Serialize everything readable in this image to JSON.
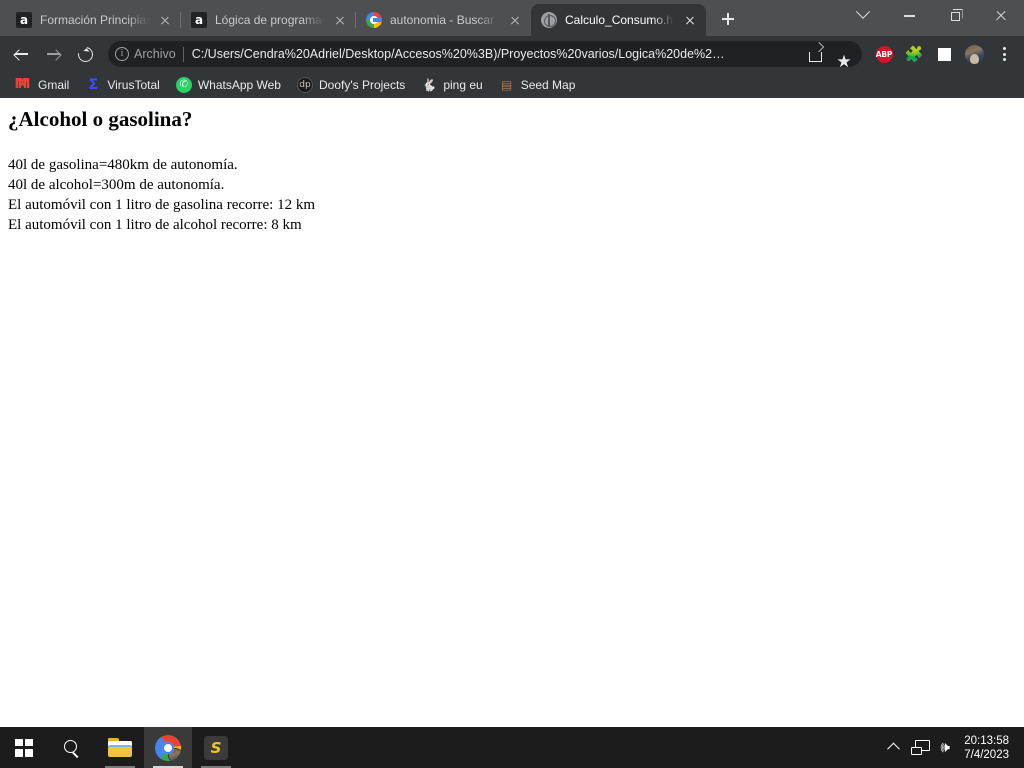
{
  "browser": {
    "tabs": [
      {
        "title": "Formación Principiante",
        "favicon": "alura-a-icon",
        "active": false
      },
      {
        "title": "Lógica de programación",
        "favicon": "alura-a-icon",
        "active": false
      },
      {
        "title": "autonomia - Buscar con",
        "favicon": "google-icon",
        "active": false
      },
      {
        "title": "Calculo_Consumo.htm",
        "favicon": "globe-icon",
        "active": true
      }
    ],
    "new_tab_label": "+",
    "window_controls": {
      "tab_search": "tab-search",
      "minimize": "minimize",
      "maximize": "maximize",
      "close": "close"
    },
    "toolbar": {
      "back": "back",
      "forward": "forward",
      "reload": "reload",
      "scheme_label": "Archivo",
      "url": "C:/Users/Cendra%20Adriel/Desktop/Accesos%20%3B)/Proyectos%20varios/Logica%20de%2…",
      "share": "share",
      "bookmark_star": "★",
      "abp_label": "ABP",
      "extensions": "🧩",
      "reading_list": "reading-list",
      "profile": "profile",
      "menu": "menu"
    },
    "bookmarks": [
      {
        "label": "Gmail",
        "icon": "M",
        "icon_class": "ic-gmail"
      },
      {
        "label": "VirusTotal",
        "icon": "Σ",
        "icon_class": "ic-vt"
      },
      {
        "label": "WhatsApp Web",
        "icon": "✆",
        "icon_class": "ic-wa"
      },
      {
        "label": "Doofy's Projects",
        "icon": "dp",
        "icon_class": "ic-doofy"
      },
      {
        "label": "ping eu",
        "icon": "🐇",
        "icon_class": "ic-ping"
      },
      {
        "label": "Seed Map",
        "icon": "▤",
        "icon_class": "ic-seed"
      }
    ]
  },
  "page": {
    "heading": "¿Alcohol o gasolina?",
    "lines": [
      "40l de gasolina=480km de autonomía.",
      "40l de alcohol=300m de autonomía.",
      "El automóvil con 1 litro de gasolina recorre: 12 km",
      "El automóvil con 1 litro de alcohol recorre: 8 km"
    ]
  },
  "taskbar": {
    "start": "windows-start",
    "search": "search",
    "file_explorer": "file-explorer",
    "chrome": "google-chrome",
    "sublime": "sublime-text",
    "sublime_glyph": "S",
    "tray": {
      "show_hidden": "show-hidden-icons",
      "network": "network",
      "volume": "volume",
      "volume_glyph": "🕪",
      "time": "20:13:58",
      "date": "7/4/2023"
    }
  }
}
